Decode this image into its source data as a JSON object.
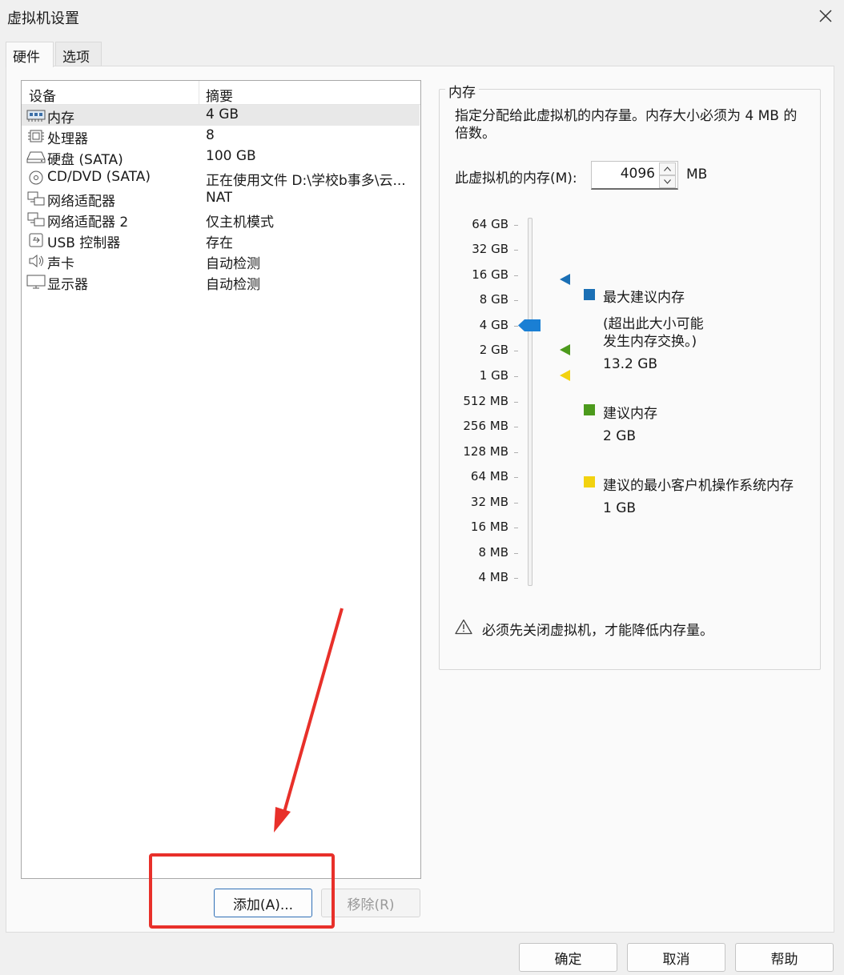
{
  "window": {
    "title": "虚拟机设置"
  },
  "tabs": [
    {
      "label": "硬件",
      "active": true
    },
    {
      "label": "选项",
      "active": false
    }
  ],
  "device_table": {
    "headers": [
      "设备",
      "摘要"
    ],
    "rows": [
      {
        "icon": "memory-icon",
        "name": "内存",
        "summary": "4 GB",
        "selected": true
      },
      {
        "icon": "processor-icon",
        "name": "处理器",
        "summary": "8"
      },
      {
        "icon": "hard-disk-icon",
        "name": "硬盘 (SATA)",
        "summary": "100 GB"
      },
      {
        "icon": "cd-dvd-icon",
        "name": "CD/DVD (SATA)",
        "summary": "正在使用文件 D:\\学校b事多\\云..."
      },
      {
        "icon": "network-adapter-icon",
        "name": "网络适配器",
        "summary": "NAT"
      },
      {
        "icon": "network-adapter-icon",
        "name": "网络适配器 2",
        "summary": "仅主机模式"
      },
      {
        "icon": "usb-icon",
        "name": "USB 控制器",
        "summary": "存在"
      },
      {
        "icon": "sound-card-icon",
        "name": "声卡",
        "summary": "自动检测"
      },
      {
        "icon": "display-icon",
        "name": "显示器",
        "summary": "自动检测"
      }
    ]
  },
  "list_buttons": {
    "add": "添加(A)...",
    "remove": "移除(R)"
  },
  "memory_panel": {
    "group_title": "内存",
    "description": "指定分配给此虚拟机的内存量。内存大小必须为 4 MB 的倍数。",
    "memory_label": "此虚拟机的内存(M):",
    "memory_value": "4096",
    "memory_unit": "MB",
    "scale_labels": [
      "64 GB",
      "32 GB",
      "16 GB",
      "8 GB",
      "4 GB",
      "2 GB",
      "1 GB",
      "512 MB",
      "256 MB",
      "128 MB",
      "64 MB",
      "32 MB",
      "16 MB",
      "8 MB",
      "4 MB"
    ],
    "current_setting": "4 GB",
    "legend": [
      {
        "color": "#1a6fb5",
        "label": "最大建议内存",
        "note_line1": "(超出此大小可能",
        "note_line2": "发生内存交换。)",
        "value": "13.2 GB"
      },
      {
        "color": "#4c9a1c",
        "label": "建议内存",
        "value": "2 GB"
      },
      {
        "color": "#f2d20f",
        "label": "建议的最小客户机操作系统内存",
        "value": "1 GB"
      }
    ],
    "warning": "必须先关闭虚拟机，才能降低内存量。"
  },
  "footer_buttons": {
    "ok": "确定",
    "cancel": "取消",
    "help": "帮助"
  },
  "colors": {
    "highlight": "#e8302a",
    "thumb": "#1a7fd4",
    "focus_border": "#2f6fb6"
  }
}
